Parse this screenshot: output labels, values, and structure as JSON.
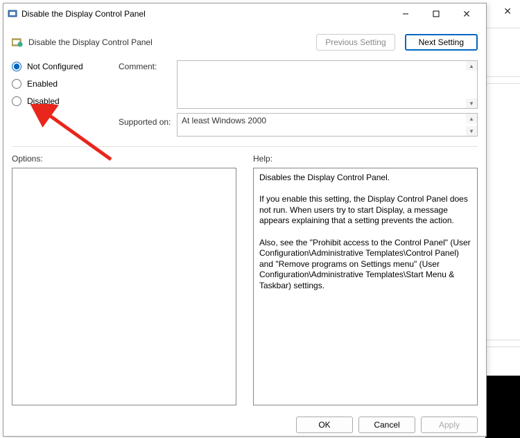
{
  "titlebar": {
    "title": "Disable the Display Control Panel"
  },
  "header": {
    "title": "Disable the Display Control Panel",
    "prev_btn": "Previous Setting",
    "next_btn": "Next Setting"
  },
  "radios": {
    "not_configured": "Not Configured",
    "enabled": "Enabled",
    "disabled": "Disabled",
    "selected": "not_configured"
  },
  "comment": {
    "label": "Comment:",
    "value": ""
  },
  "supported": {
    "label": "Supported on:",
    "value": "At least Windows 2000"
  },
  "panels": {
    "options_label": "Options:",
    "help_label": "Help:",
    "options_text": "",
    "help_text": "Disables the Display Control Panel.\n\nIf you enable this setting, the Display Control Panel does not run. When users try to start Display, a message appears explaining that a setting prevents the action.\n\nAlso, see the \"Prohibit access to the Control Panel\" (User Configuration\\Administrative Templates\\Control Panel) and \"Remove programs on Settings menu\" (User Configuration\\Administrative Templates\\Start Menu & Taskbar) settings."
  },
  "footer": {
    "ok": "OK",
    "cancel": "Cancel",
    "apply": "Apply"
  }
}
